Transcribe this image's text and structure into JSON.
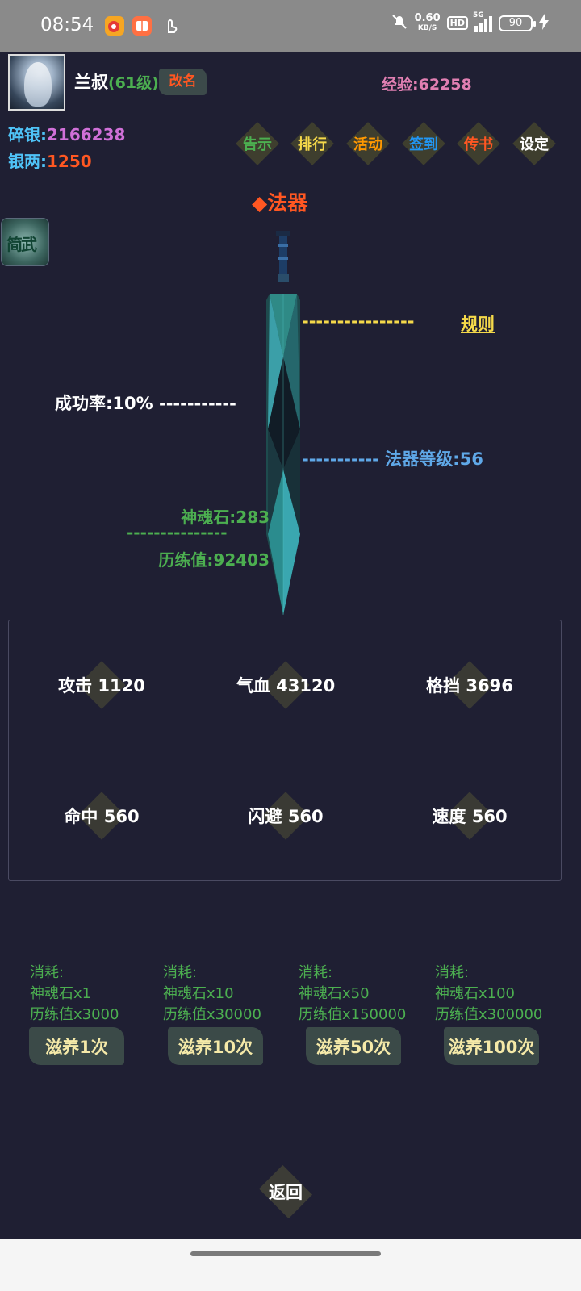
{
  "status": {
    "time": "08:54",
    "net_speed": "0.60",
    "net_unit": "KB/S",
    "hd": "HD",
    "signal": "5G",
    "battery": "90"
  },
  "player": {
    "name": "兰叔",
    "level": "(61级)",
    "rename_label": "改名",
    "exp_label": "经验:62258"
  },
  "currency": {
    "silver_label": "碎银:",
    "silver_value": "2166238",
    "taels_label": "银两:",
    "taels_value": "1250"
  },
  "menu": [
    {
      "label": "告示",
      "color": "#4caf50"
    },
    {
      "label": "排行",
      "color": "#f5d94a"
    },
    {
      "label": "活动",
      "color": "#ff9800"
    },
    {
      "label": "签到",
      "color": "#2196f3"
    },
    {
      "label": "传书",
      "color": "#ff5722"
    },
    {
      "label": "设定",
      "color": "#ffffff"
    }
  ],
  "artifact": {
    "title": "◆法器",
    "side_icon_text": "简武",
    "rules_dash": "----------------",
    "rules_label": "规则",
    "success": "成功率:10% -----------",
    "level": "----------- 法器等级:56",
    "stone": "神魂石:283",
    "divider": "---------------",
    "experience": "历练值:92403"
  },
  "stats": [
    {
      "label": "攻击 1120"
    },
    {
      "label": "气血 43120"
    },
    {
      "label": "格挡 3696"
    },
    {
      "label": "命中 560"
    },
    {
      "label": "闪避 560"
    },
    {
      "label": "速度 560"
    }
  ],
  "nourish": [
    {
      "cost_title": "消耗:",
      "stone": "神魂石x1",
      "exp": "历练值x3000",
      "button": "滋养1次"
    },
    {
      "cost_title": "消耗:",
      "stone": "神魂石x10",
      "exp": "历练值x30000",
      "button": "滋养10次"
    },
    {
      "cost_title": "消耗:",
      "stone": "神魂石x50",
      "exp": "历练值x150000",
      "button": "滋养50次"
    },
    {
      "cost_title": "消耗:",
      "stone": "神魂石x100",
      "exp": "历练值x300000",
      "button": "滋养100次"
    }
  ],
  "back_label": "返回"
}
